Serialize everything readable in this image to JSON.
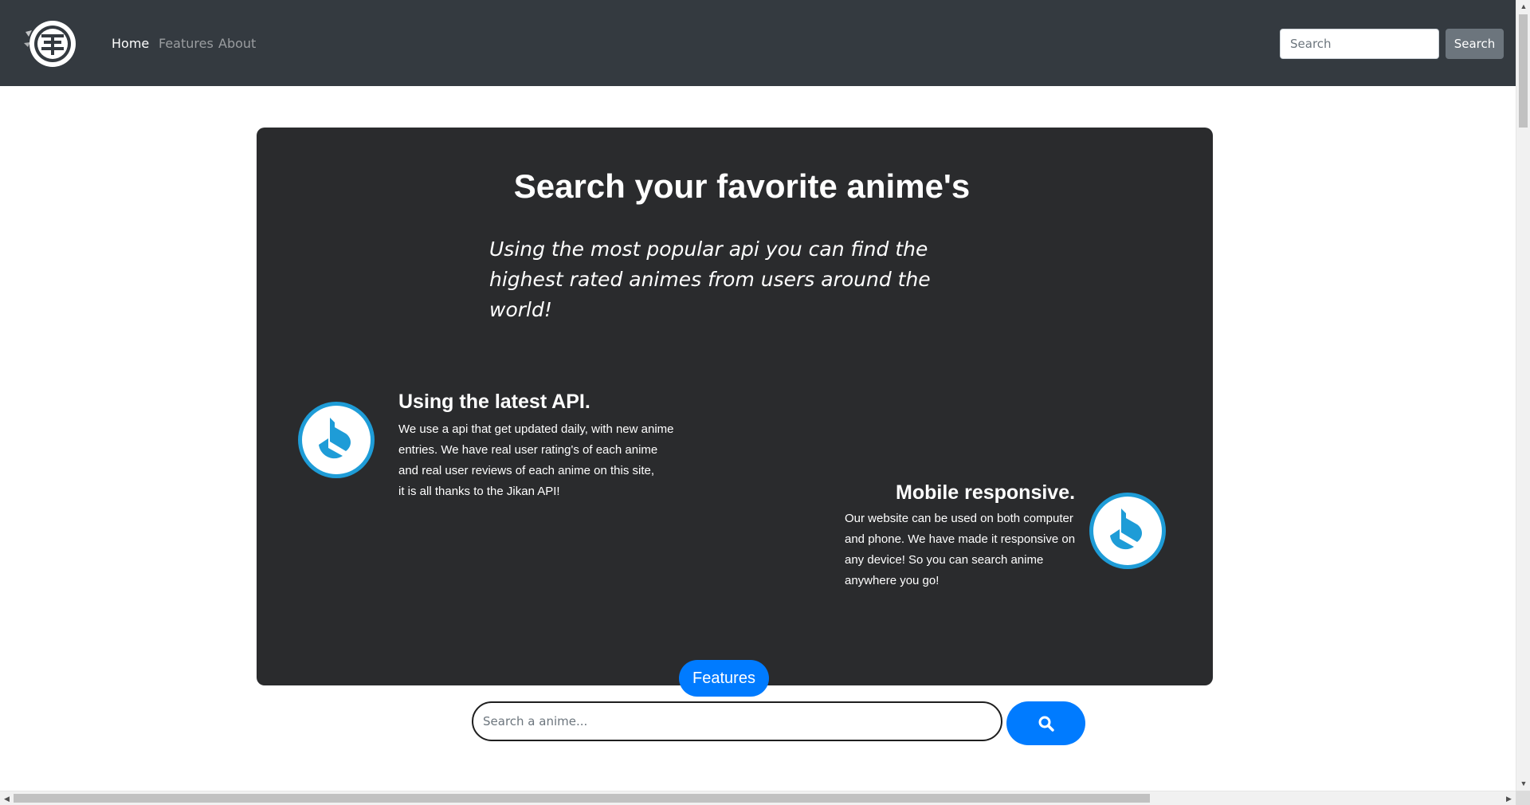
{
  "navbar": {
    "logo_icon": "anime-emblem-logo",
    "links": [
      {
        "label": "Home",
        "active": true
      },
      {
        "label": "Features",
        "active": false
      },
      {
        "label": "About",
        "active": false
      }
    ],
    "search_placeholder": "Search",
    "search_button": "Search",
    "background": "#343a40"
  },
  "hero": {
    "title": "Search your favorite anime's",
    "subtitle": "Using the most popular api you can find the highest rated animes from users around the world!",
    "background": "#2a2b2d"
  },
  "features": [
    {
      "icon": "jikan-drop-icon",
      "title": "Using the latest API.",
      "lines": [
        "We use a api that get updated daily, with new anime",
        "entries. We have real user rating's of each anime",
        "and real user reviews of each anime on this site,",
        "it is all thanks to the Jikan API!"
      ]
    },
    {
      "icon": "jikan-drop-icon",
      "title": "Mobile responsive.",
      "lines": [
        "Our website can be used on both computer",
        "and phone. We have made it responsive on",
        "any device! So you can search anime",
        "anywhere you go!"
      ]
    }
  ],
  "features_button": "Features",
  "main_search": {
    "placeholder": "Search a anime...",
    "button_icon": "search-icon"
  },
  "colors": {
    "accent": "#007bff",
    "icon_blue": "#1e9cd7"
  }
}
